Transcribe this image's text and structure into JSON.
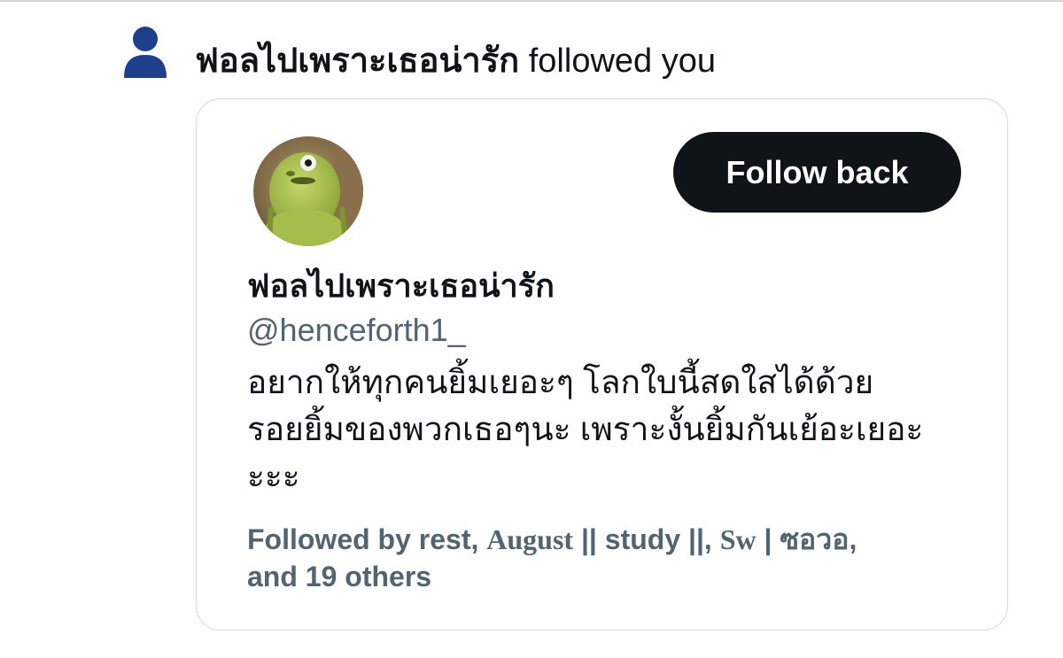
{
  "notification": {
    "name": "ฟอลไปเพราะเธอน่ารัก",
    "action": " followed you",
    "icon": "person-icon",
    "icon_color": "#1d3f8c"
  },
  "card": {
    "follow_back_label": "Follow back",
    "display_name": "ฟอลไปเพราะเธอน่ารัก",
    "handle": "@henceforth1_",
    "bio_lines": [
      "อยากให้ทุกคนยิ้มเยอะๆ โลกใบนี้สดใสได้ด้วย",
      "รอยยิ้มของพวกเธอๆนะ เพราะงั้นยิ้มกันเย้อะเยอะ",
      "ะะะ"
    ],
    "followed_by": {
      "prefix": "Followed by rest, ",
      "user2": "August",
      "sep1": " || study ||, ",
      "user3": "Sw",
      "sep2": " | ซอวอ,",
      "line2": "and 19 others"
    }
  },
  "colors": {
    "button_bg": "#0f1419",
    "secondary_text": "#536471",
    "card_border": "#cfd9de"
  }
}
